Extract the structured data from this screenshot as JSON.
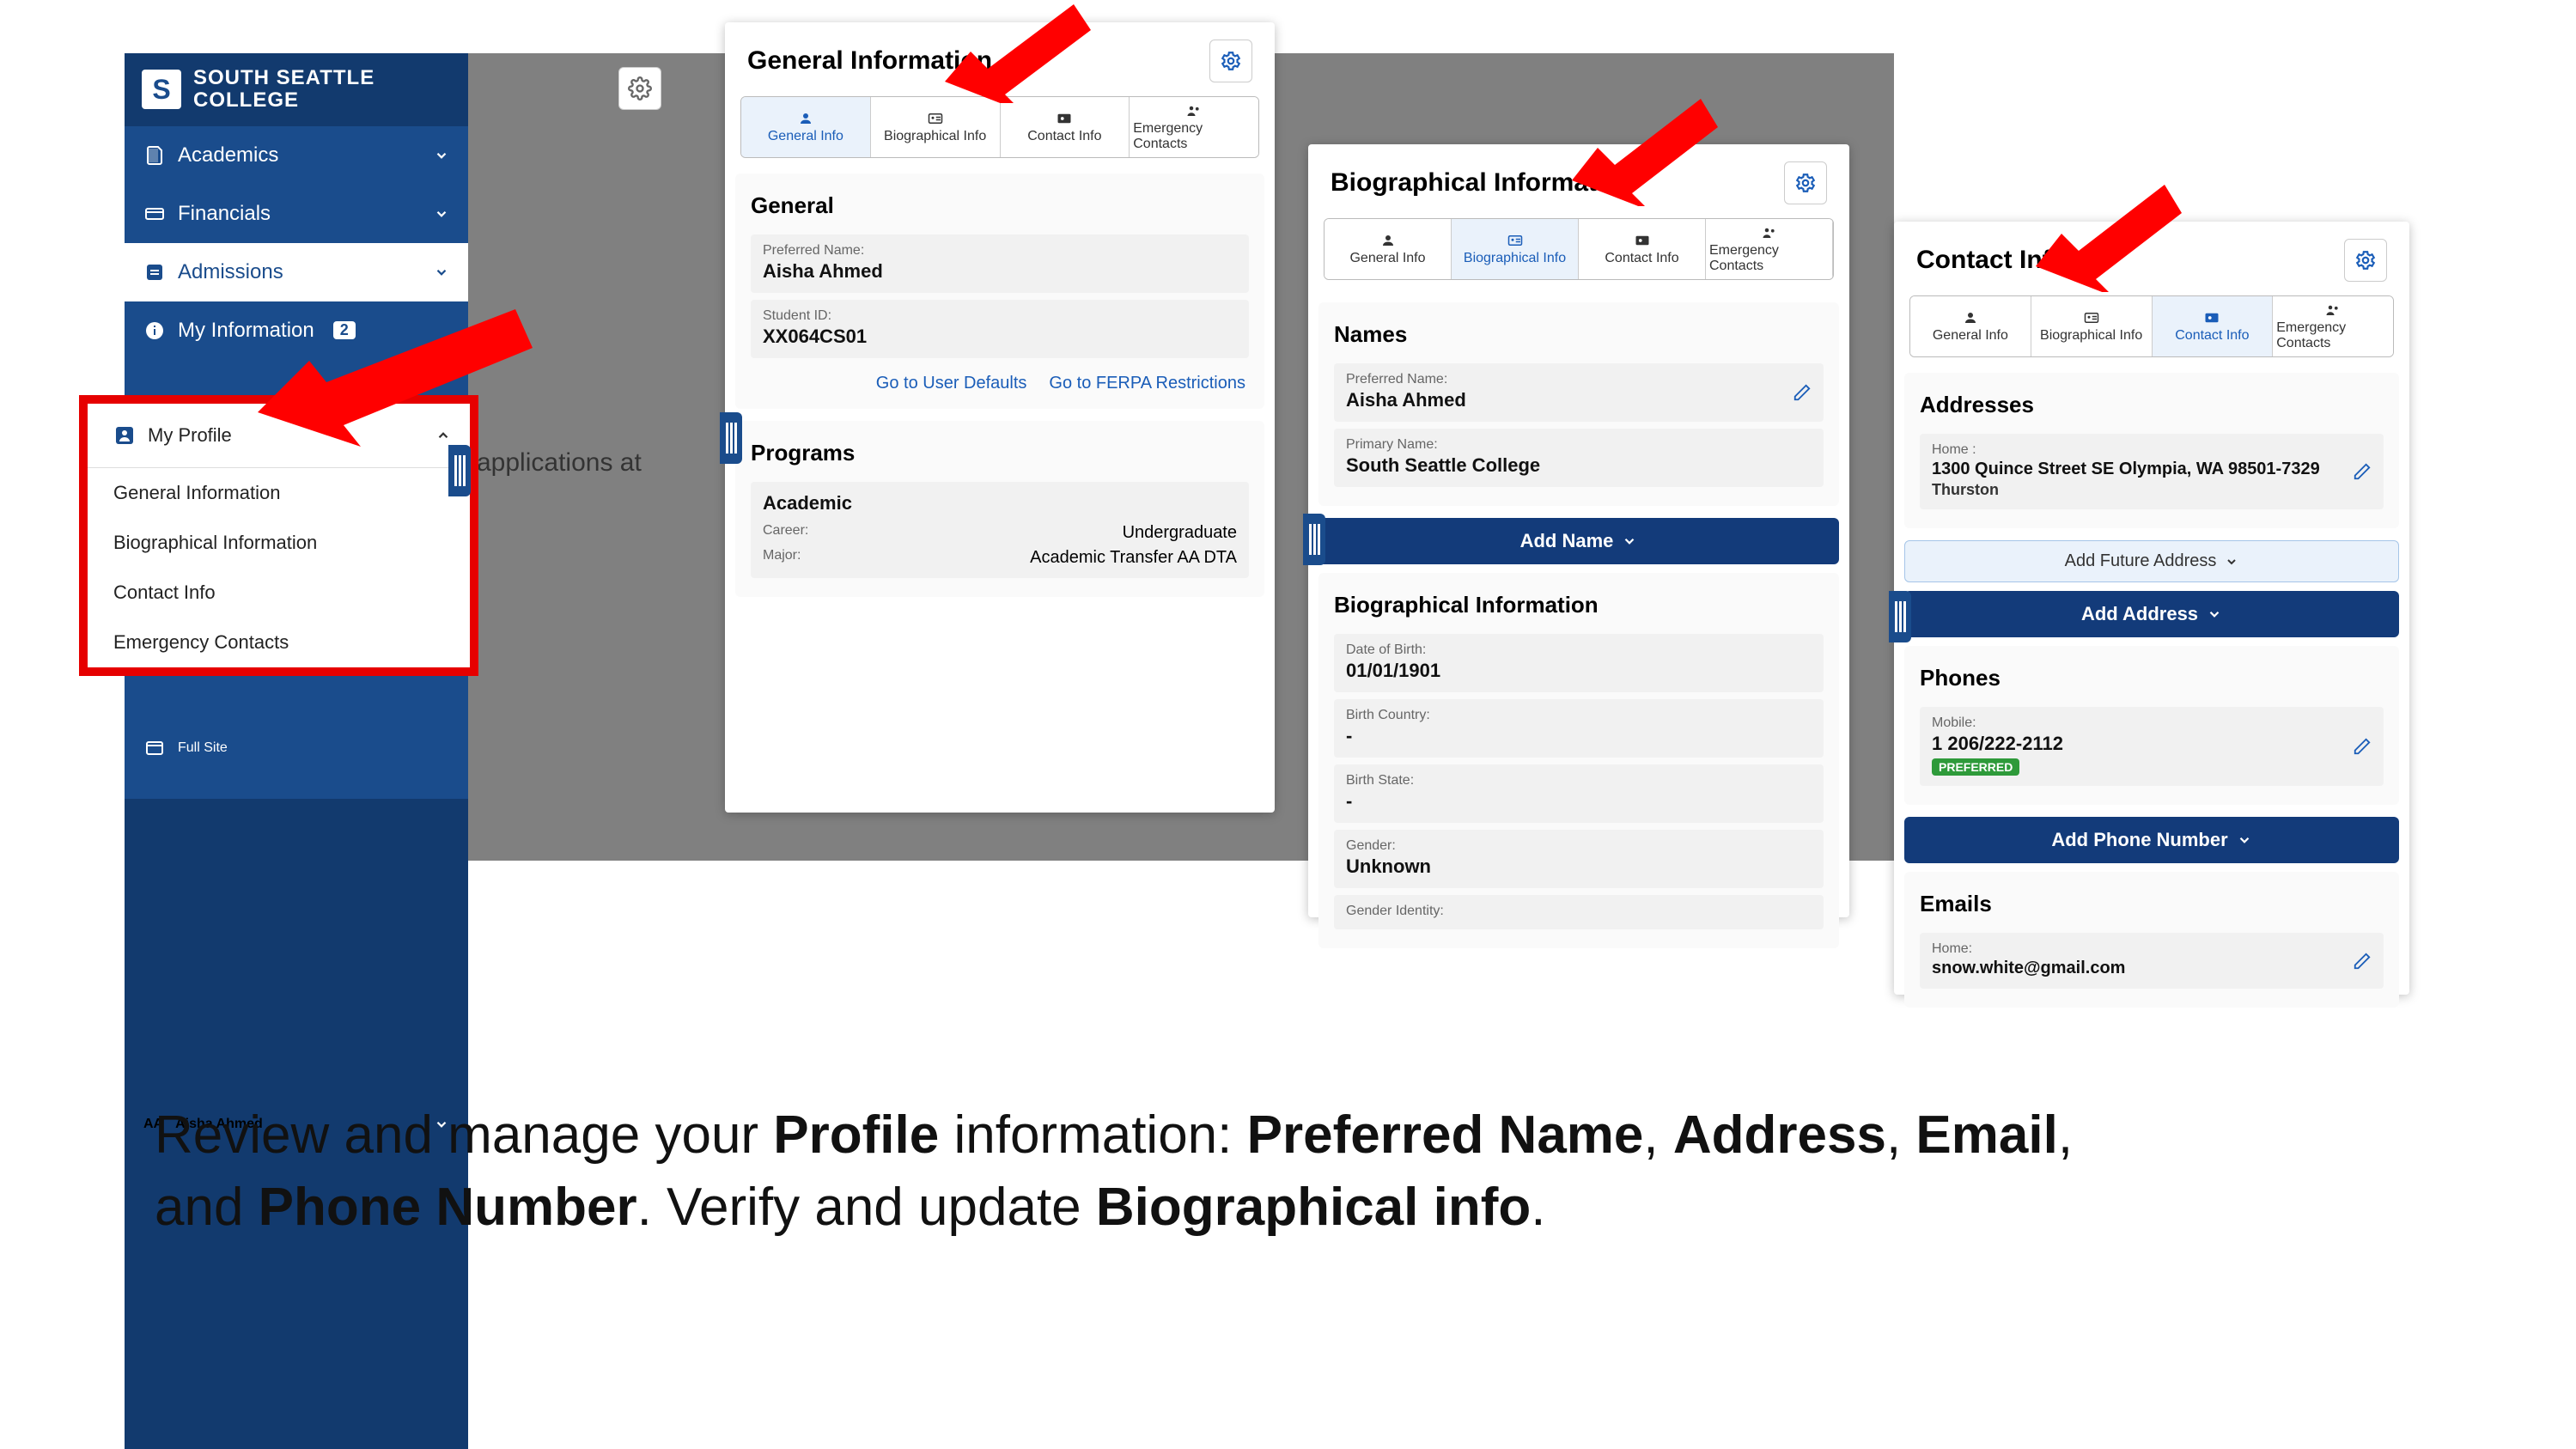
{
  "sidebar": {
    "brand_top": "SOUTH SEATTLE",
    "brand_bottom": "COLLEGE",
    "items": {
      "academics": "Academics",
      "financials": "Financials",
      "admissions": "Admissions",
      "my_information": "My Information",
      "my_info_badge": "2",
      "my_profile": "My Profile",
      "sub_general": "General Information",
      "sub_bio": "Biographical Information",
      "sub_contact": "Contact Info",
      "sub_emergency": "Emergency Contacts",
      "full_site": "Full Site",
      "user_initials": "AA",
      "user_name": "Aisha Ahmed"
    }
  },
  "bg_text": "applications at",
  "tabs": {
    "general": "General Info",
    "bio": "Biographical Info",
    "contact": "Contact Info",
    "emergency": "Emergency Contacts"
  },
  "card1": {
    "title": "General Information",
    "section_general": "General",
    "pref_name_label": "Preferred Name:",
    "pref_name_value": "Aisha Ahmed",
    "student_id_label": "Student ID:",
    "student_id_value": "XX064CS01",
    "link_user_defaults": "Go to User Defaults",
    "link_ferpa": "Go to FERPA Restrictions",
    "section_programs": "Programs",
    "academic": "Academic",
    "career_label": "Career:",
    "career_value": "Undergraduate",
    "major_label": "Major:",
    "major_value": "Academic Transfer AA DTA"
  },
  "card2": {
    "title": "Biographical Information",
    "tooltip": "Biographical Info",
    "section_names": "Names",
    "pref_name_label": "Preferred Name:",
    "pref_name_value": "Aisha Ahmed",
    "primary_label": "Primary Name:",
    "primary_value": "South Seattle College",
    "add_name_btn": "Add Name",
    "section_bio": "Biographical Information",
    "dob_label": "Date of Birth:",
    "dob_value": "01/01/1901",
    "birth_country_label": "Birth Country:",
    "birth_country_value": "-",
    "birth_state_label": "Birth State:",
    "birth_state_value": "-",
    "gender_label": "Gender:",
    "gender_value": "Unknown",
    "gender_identity_label": "Gender Identity:"
  },
  "card3": {
    "title": "Contact Info",
    "section_addresses": "Addresses",
    "addr_label": "Home :",
    "addr_line1": "1300 Quince Street SE Olympia, WA 98501-7329",
    "addr_line2": "Thurston",
    "add_future_btn": "Add Future Address",
    "add_address_btn": "Add Address",
    "section_phones": "Phones",
    "phone_label": "Mobile:",
    "phone_value": "1 206/222-2112",
    "preferred": "PREFERRED",
    "add_phone_btn": "Add Phone Number",
    "section_emails": "Emails",
    "email_label": "Home:",
    "email_value": "snow.white@gmail.com"
  },
  "caption": {
    "p1a": "Review and manage your ",
    "p1b": "Profile",
    "p1c": " information: ",
    "p1d": "Preferred Name",
    "p1e": ", ",
    "p1f": "Address",
    "p1g": ", ",
    "p1h": "Email",
    "p1i": ",",
    "p2a": "and ",
    "p2b": "Phone Number",
    "p2c": ".  Verify and update ",
    "p2d": "Biographical info",
    "p2e": "."
  }
}
